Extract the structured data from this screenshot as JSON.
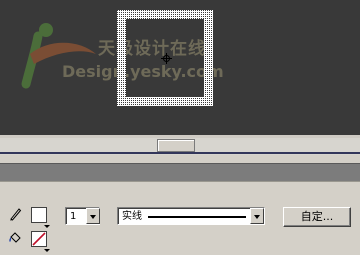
{
  "watermark": {
    "cn": "天极设计在线",
    "en": "Design.yesky.com"
  },
  "properties": {
    "stroke_width_value": "1",
    "stroke_style_value": "实线",
    "custom_button_label": "自定..."
  },
  "icons": {
    "pencil": "pencil-icon",
    "bucket": "paint-bucket-icon",
    "crosshair": "crosshair-icon",
    "no_fill": "no-fill-swatch-icon"
  },
  "colors": {
    "stage_bg": "#393939",
    "panel_bg": "#d4d0c8",
    "panel_title_bg": "#7c7c7c",
    "no_fill_slash": "#c0102a"
  }
}
